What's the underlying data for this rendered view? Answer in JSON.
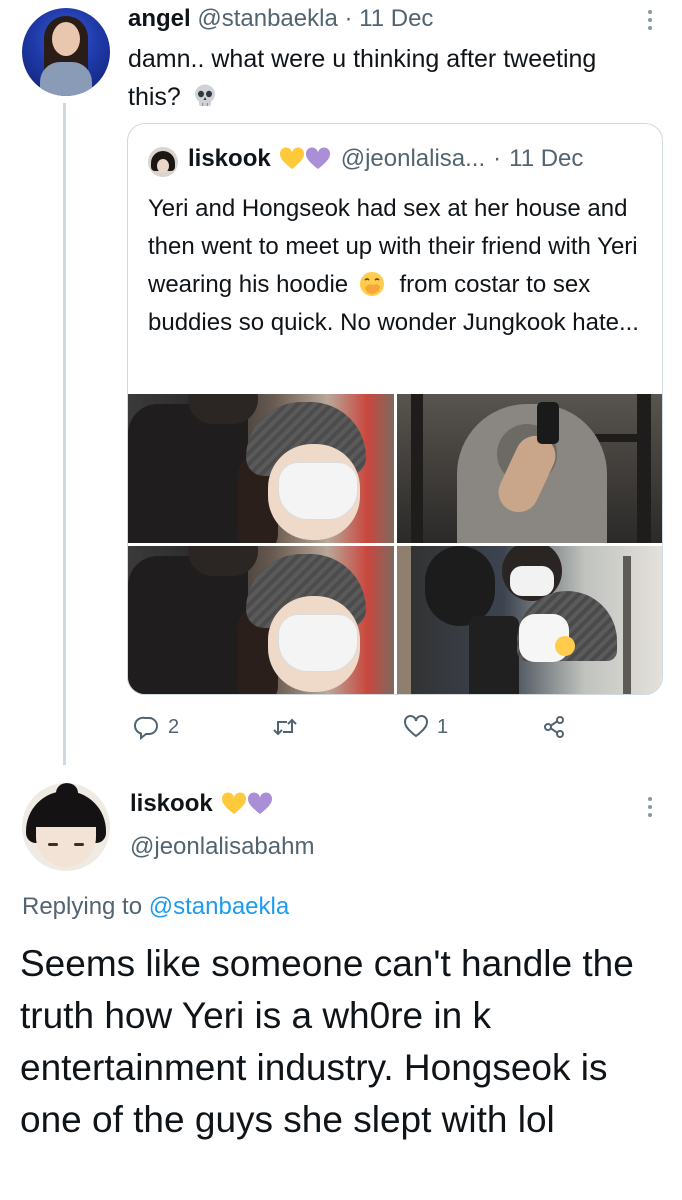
{
  "tweet": {
    "author_name": "angel",
    "author_handle": "@stanbaekla",
    "separator": "·",
    "date": "11 Dec",
    "text": "damn.. what were u thinking after tweeting this?",
    "emoji": "skull-emoji",
    "quote": {
      "author_name": "liskook",
      "author_emojis": [
        "yellow-heart-emoji",
        "purple-heart-emoji"
      ],
      "author_handle": "@jeonlalisa...",
      "separator": "·",
      "date": "11 Dec",
      "text_before_emoji": "Yeri and Hongseok had sex at her house and then went to meet up with their friend with Yeri wearing his hoodie",
      "emoji": "face-with-hand-over-mouth-emoji",
      "text_after_emoji": "from costar to sex buddies so quick. No wonder Jungkook hate...",
      "photos": [
        "selfie-beanie-mask",
        "gym-mirror-selfie",
        "selfie-beanie-mask",
        "couple-mirror-selfie"
      ]
    },
    "actions": {
      "replies": "2",
      "retweets": "",
      "likes": "1"
    }
  },
  "reply": {
    "author_name": "liskook",
    "author_emojis": [
      "yellow-heart-emoji",
      "purple-heart-emoji"
    ],
    "author_handle": "@jeonlalisabahm",
    "replying_to_prefix": "Replying to",
    "replying_to_handle": "@stanbaekla",
    "text": "Seems like someone can't handle the truth how Yeri is a wh0re in k entertainment industry. Hongseok is one of the guys she slept with lol"
  },
  "colors": {
    "text": "#0f1419",
    "muted": "#536471",
    "link": "#1d9bf0",
    "border": "#cfd9de",
    "yellow_heart": "#ffc93c",
    "purple_heart": "#aa8ed6"
  }
}
